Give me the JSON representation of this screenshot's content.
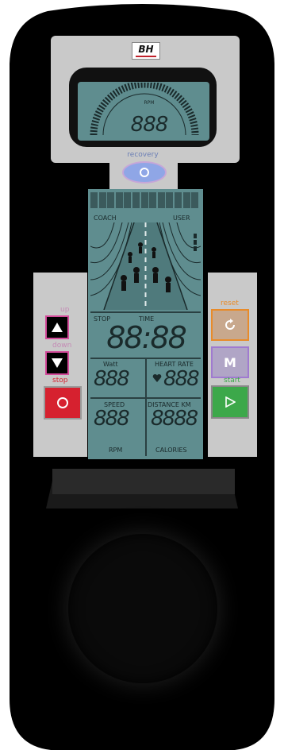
{
  "brand": {
    "logo_text": "BH",
    "accent": "#c0202a"
  },
  "rpm_display": {
    "scale_label": "RPM",
    "value": "888"
  },
  "recovery": {
    "label": "recovery",
    "icon": "circle-icon"
  },
  "main_display": {
    "coach_label": "COACH",
    "user_label": "USER",
    "stop_label": "STOP",
    "time_label": "TIME",
    "time_value": "88:88",
    "watt_label": "Watt",
    "watt_value": "888",
    "hr_label": "HEART RATE",
    "hr_value": "888",
    "speed_label": "SPEED",
    "speed_value": "888",
    "rpm_label": "RPM",
    "distance_label": "DISTANCE KM",
    "distance_value": "8888",
    "calories_label": "CALORIES"
  },
  "buttons": {
    "up_label": "up",
    "down_label": "down",
    "stop_label": "stop",
    "reset_label": "reset",
    "mode_glyph": "M",
    "start_label": "start"
  },
  "colors": {
    "lcd": "#5f8d8f",
    "panel": "#c9c9c9",
    "stop": "#d6212f",
    "start": "#3ca84a",
    "reset": "#e88b2a",
    "mode": "#a07ad0",
    "recovery": "#8fa6e6"
  }
}
